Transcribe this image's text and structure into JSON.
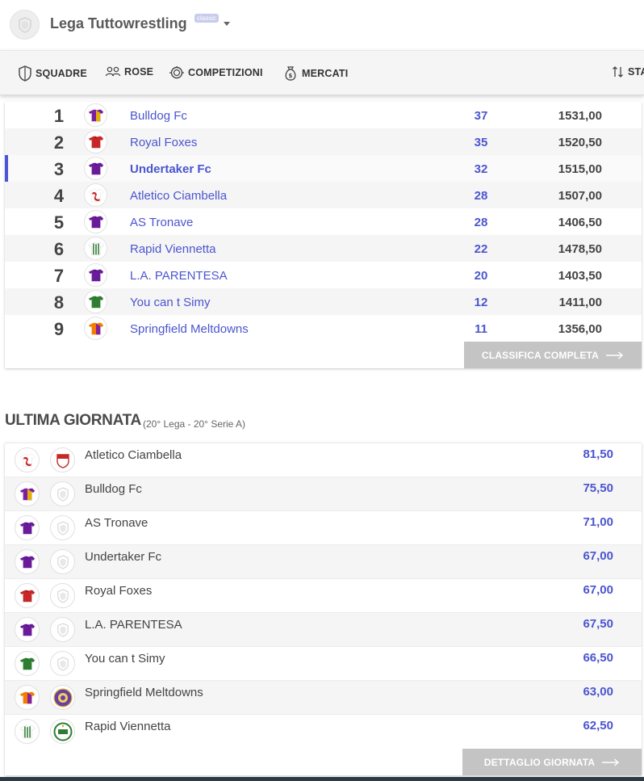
{
  "header": {
    "title": "Lega Tuttowrestling",
    "badge": "classic"
  },
  "nav": {
    "items": [
      {
        "label": "SQUADRE",
        "icon": "shield-icon"
      },
      {
        "label": "ROSE",
        "icon": "users-icon"
      },
      {
        "label": "COMPETIZIONI",
        "icon": "trophy-icon"
      },
      {
        "label": "MERCATI",
        "icon": "money-bag-icon"
      },
      {
        "label": "STA",
        "icon": "sort-icon"
      }
    ]
  },
  "standings": {
    "rows": [
      {
        "pos": "1",
        "team": "Bulldog Fc",
        "points": "37",
        "total": "1531,00",
        "jersey": "purple-gold"
      },
      {
        "pos": "2",
        "team": "Royal Foxes",
        "points": "35",
        "total": "1520,50",
        "jersey": "red"
      },
      {
        "pos": "3",
        "team": "Undertaker Fc",
        "points": "32",
        "total": "1515,00",
        "jersey": "purple",
        "active": true
      },
      {
        "pos": "4",
        "team": "Atletico Ciambella",
        "points": "28",
        "total": "1507,00",
        "jersey": "red-white-swirl"
      },
      {
        "pos": "5",
        "team": "AS Tronave",
        "points": "28",
        "total": "1406,50",
        "jersey": "purple"
      },
      {
        "pos": "6",
        "team": "Rapid Viennetta",
        "points": "22",
        "total": "1478,50",
        "jersey": "green-stripes"
      },
      {
        "pos": "7",
        "team": "L.A. PARENTESA",
        "points": "20",
        "total": "1403,50",
        "jersey": "purple"
      },
      {
        "pos": "8",
        "team": "You can t Simy",
        "points": "12",
        "total": "1411,00",
        "jersey": "green"
      },
      {
        "pos": "9",
        "team": "Springfield Meltdowns",
        "points": "11",
        "total": "1356,00",
        "jersey": "orange-purple"
      }
    ],
    "button_label": "CLASSIFICA COMPLETA"
  },
  "matchday": {
    "title": "ULTIMA GIORNATA",
    "subtitle": "(20° Lega - 20° Serie A)",
    "rows": [
      {
        "team": "Atletico Ciambella",
        "score": "81,50",
        "jersey": "red-white-swirl",
        "logo": "red-crest"
      },
      {
        "team": "Bulldog Fc",
        "score": "75,50",
        "jersey": "purple-gold",
        "logo": "default-shield"
      },
      {
        "team": "AS Tronave",
        "score": "71,00",
        "jersey": "purple",
        "logo": "default-shield"
      },
      {
        "team": "Undertaker Fc",
        "score": "67,00",
        "jersey": "purple",
        "logo": "default-shield"
      },
      {
        "team": "Royal Foxes",
        "score": "67,00",
        "jersey": "red",
        "logo": "default-shield"
      },
      {
        "team": "L.A. PARENTESA",
        "score": "67,50",
        "jersey": "purple",
        "logo": "default-shield"
      },
      {
        "team": "You can t Simy",
        "score": "66,50",
        "jersey": "green",
        "logo": "default-shield"
      },
      {
        "team": "Springfield Meltdowns",
        "score": "63,00",
        "jersey": "orange-purple",
        "logo": "purple-crest"
      },
      {
        "team": "Rapid Viennetta",
        "score": "62,50",
        "jersey": "green-stripes",
        "logo": "green-crest"
      }
    ],
    "button_label": "DETTAGLIO GIORNATA"
  },
  "colors": {
    "accent": "#4b55cf",
    "active_bar": "#4a55d8",
    "button_grey": "#c4c4c4",
    "nav_bg": "#f5f5f5"
  }
}
